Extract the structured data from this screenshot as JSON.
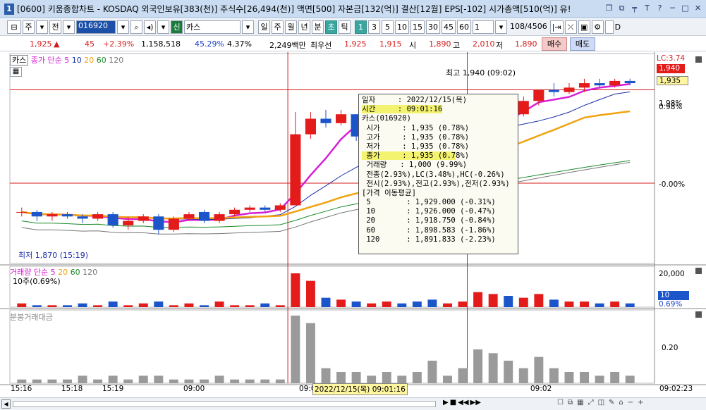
{
  "window": {
    "number": "1",
    "title": "[0600] 키움종합차트 - KOSDAQ 외국인보유[383(천)] 주식수[26,494(천)] 액면[500] 자본금[132(억)] 결산[12월] EPS[-102] 시가총액[510(억)] 유!",
    "icons": [
      "restore-icon",
      "tile-icon",
      "pin-icon",
      "font-icon",
      "help-icon",
      "minimize-icon",
      "maximize-icon",
      "close-icon"
    ]
  },
  "toolbar": {
    "type_label": "주",
    "prev_label": "전",
    "code_value": "016920",
    "market_badge": "신",
    "name_value": "카스",
    "periods": [
      "일",
      "주",
      "월",
      "년",
      "분",
      "초",
      "틱"
    ],
    "selected_period": "초",
    "intervals": [
      "1",
      "3",
      "5",
      "10",
      "15",
      "30",
      "45",
      "60"
    ],
    "selected_interval": "1",
    "count_value": "1",
    "page_info": "108/4506",
    "check_label": "D"
  },
  "quote": {
    "price": "1,925",
    "arrow": "▲",
    "change": "45",
    "change_pct": "+2.39%",
    "volume": "1,158,518",
    "volume_ratio": "45.29%",
    "turnover": "4.37%",
    "amount": "2,249백만",
    "best_label": "최우선",
    "ask": "1,925",
    "bid": "1,915",
    "open_label": "시",
    "open": "1,890",
    "high_label": "고",
    "high": "2,010",
    "low_label": "저",
    "low": "1,890",
    "buy_label": "매수",
    "sell_label": "매도"
  },
  "price_panel": {
    "legend_name": "카스",
    "legend_ma_title": "종가 단순",
    "ma_periods": [
      "5",
      "10",
      "20",
      "60",
      "120"
    ],
    "ma_colors": [
      "#d61fd6",
      "#1a2fa8",
      "#f0a20f",
      "#1a8a2a",
      "#777777"
    ],
    "lc_label": "LC:3.74",
    "price_box": "1,940",
    "price_box2": "1,935",
    "right_labels": [
      "1.98%",
      "0.98%",
      "-0.00%"
    ],
    "high_annotation": "최고 1,940 (09:02)",
    "low_annotation": "최저 1,870 (15:19)"
  },
  "volume_panel": {
    "legend_title": "거래량 단순",
    "ma_periods": [
      "5",
      "20",
      "60",
      "120"
    ],
    "sub_label": "10주(0.69%)",
    "axis_top": "20,000",
    "box_value": "10",
    "box_pct": "0.69%"
  },
  "amount_panel": {
    "legend_title": "분봉거래대금",
    "axis_label": "0.20"
  },
  "x_axis": {
    "labels": [
      "15:16",
      "15:18",
      "15:19",
      "09:00",
      "09:0",
      "09:02",
      "09:02:23"
    ],
    "cursor_label": "2022/12/15(목) 09:01:16"
  },
  "tooltip": {
    "rows": [
      "일자     : 2022/12/15(목)",
      "시간     : 09:01:16",
      "카스(016920)",
      " 시가     : 1,935 (0.78%)",
      " 고가     : 1,935 (0.78%)",
      " 저가     : 1,935 (0.78%)",
      " 종가     : 1,935 (0.78%)",
      " 거래량   : 1,000 (9.99%)",
      " 전종(2.93%),LC(3.48%),HC(-0.26%)",
      " 전시(2.93%),전고(2.93%),전저(2.93%)",
      "[가격 이동평균]",
      " 5        : 1,929.000 (-0.31%)",
      " 10       : 1,926.000 (-0.47%)",
      " 20       : 1,918.750 (-0.84%)",
      " 60       : 1,898.583 (-1.86%)",
      " 120      : 1,891.833 (-2.23%)"
    ],
    "highlight_rows": [
      1,
      6
    ]
  },
  "chart_data": {
    "type": "candlestick",
    "y_range": [
      1860,
      1945
    ],
    "candles": [
      {
        "o": 1880,
        "h": 1882,
        "l": 1878,
        "c": 1880
      },
      {
        "o": 1880,
        "h": 1881,
        "l": 1876,
        "c": 1878
      },
      {
        "o": 1878,
        "h": 1880,
        "l": 1876,
        "c": 1879
      },
      {
        "o": 1879,
        "h": 1880,
        "l": 1877,
        "c": 1878
      },
      {
        "o": 1878,
        "h": 1879,
        "l": 1875,
        "c": 1877
      },
      {
        "o": 1877,
        "h": 1880,
        "l": 1876,
        "c": 1879
      },
      {
        "o": 1879,
        "h": 1880,
        "l": 1873,
        "c": 1874
      },
      {
        "o": 1874,
        "h": 1878,
        "l": 1872,
        "c": 1876
      },
      {
        "o": 1876,
        "h": 1879,
        "l": 1875,
        "c": 1878
      },
      {
        "o": 1878,
        "h": 1879,
        "l": 1870,
        "c": 1872
      },
      {
        "o": 1872,
        "h": 1878,
        "l": 1871,
        "c": 1877
      },
      {
        "o": 1877,
        "h": 1880,
        "l": 1876,
        "c": 1879
      },
      {
        "o": 1880,
        "h": 1881,
        "l": 1875,
        "c": 1876
      },
      {
        "o": 1876,
        "h": 1880,
        "l": 1875,
        "c": 1879
      },
      {
        "o": 1879,
        "h": 1882,
        "l": 1878,
        "c": 1881
      },
      {
        "o": 1881,
        "h": 1883,
        "l": 1880,
        "c": 1882
      },
      {
        "o": 1882,
        "h": 1883,
        "l": 1880,
        "c": 1881
      },
      {
        "o": 1881,
        "h": 1884,
        "l": 1880,
        "c": 1883
      },
      {
        "o": 1883,
        "h": 1925,
        "l": 1883,
        "c": 1915
      },
      {
        "o": 1915,
        "h": 1925,
        "l": 1913,
        "c": 1922
      },
      {
        "o": 1922,
        "h": 1926,
        "l": 1918,
        "c": 1920
      },
      {
        "o": 1920,
        "h": 1926,
        "l": 1919,
        "c": 1924
      },
      {
        "o": 1924,
        "h": 1924,
        "l": 1912,
        "c": 1914
      },
      {
        "o": 1914,
        "h": 1918,
        "l": 1912,
        "c": 1916
      },
      {
        "o": 1916,
        "h": 1922,
        "l": 1915,
        "c": 1921
      },
      {
        "o": 1921,
        "h": 1922,
        "l": 1915,
        "c": 1916
      },
      {
        "o": 1916,
        "h": 1920,
        "l": 1912,
        "c": 1914
      },
      {
        "o": 1914,
        "h": 1916,
        "l": 1906,
        "c": 1908
      },
      {
        "o": 1908,
        "h": 1912,
        "l": 1907,
        "c": 1911
      },
      {
        "o": 1911,
        "h": 1916,
        "l": 1910,
        "c": 1914
      },
      {
        "o": 1914,
        "h": 1930,
        "l": 1913,
        "c": 1928
      },
      {
        "o": 1928,
        "h": 1932,
        "l": 1926,
        "c": 1930
      },
      {
        "o": 1930,
        "h": 1932,
        "l": 1922,
        "c": 1924
      },
      {
        "o": 1924,
        "h": 1932,
        "l": 1923,
        "c": 1930
      },
      {
        "o": 1930,
        "h": 1935,
        "l": 1928,
        "c": 1935
      },
      {
        "o": 1935,
        "h": 1938,
        "l": 1932,
        "c": 1934
      },
      {
        "o": 1934,
        "h": 1938,
        "l": 1933,
        "c": 1936
      },
      {
        "o": 1936,
        "h": 1940,
        "l": 1934,
        "c": 1938
      },
      {
        "o": 1938,
        "h": 1940,
        "l": 1936,
        "c": 1937
      },
      {
        "o": 1937,
        "h": 1940,
        "l": 1936,
        "c": 1939
      },
      {
        "o": 1939,
        "h": 1940,
        "l": 1937,
        "c": 1938
      }
    ],
    "volume": [
      2,
      1,
      1,
      1,
      2,
      1,
      3,
      1,
      2,
      3,
      1,
      2,
      1,
      3,
      1,
      1,
      2,
      1,
      18,
      14,
      5,
      4,
      3,
      2,
      3,
      2,
      3,
      4,
      2,
      3,
      8,
      7,
      6,
      5,
      7,
      4,
      3,
      3,
      2,
      3,
      2
    ],
    "amount": [
      1,
      1,
      1,
      1,
      2,
      1,
      2,
      1,
      2,
      2,
      1,
      1,
      1,
      2,
      1,
      1,
      1,
      1,
      18,
      16,
      4,
      3,
      3,
      2,
      3,
      2,
      3,
      6,
      2,
      4,
      9,
      8,
      6,
      4,
      7,
      4,
      3,
      3,
      2,
      3,
      2
    ]
  }
}
